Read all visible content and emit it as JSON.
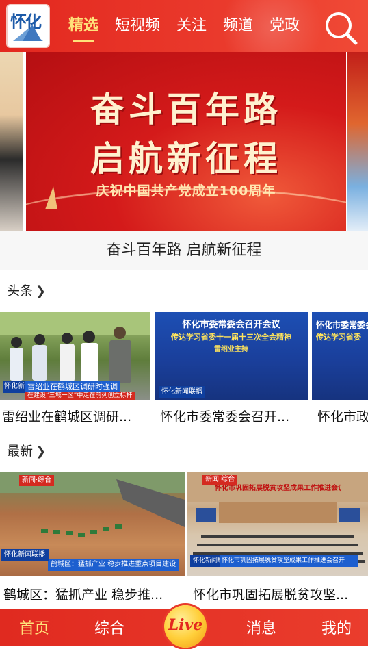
{
  "header": {
    "logo_text": "怀化",
    "tabs": [
      {
        "label": "精选",
        "active": true
      },
      {
        "label": "短视频",
        "active": false
      },
      {
        "label": "关注",
        "active": false
      },
      {
        "label": "频道",
        "active": false
      },
      {
        "label": "党政",
        "active": false
      }
    ],
    "search_icon": "search-icon",
    "colors": {
      "bar": "#e3281f",
      "active_tab": "#ffe27a"
    }
  },
  "banner": {
    "title_line1": "奋斗百年路",
    "title_line2": "启航新征程",
    "subtitle": "庆祝中国共产党成立100周年",
    "caption": "奋斗百年路 启航新征程"
  },
  "headlines": {
    "section_label": "头条",
    "section_icon": "chevron-right-icon",
    "cards": [
      {
        "caption": "雷绍业在鹤城区调研...",
        "badge": "怀化新闻联播",
        "lower_third_1": "雷绍业在鹤城区调研时强调",
        "lower_third_2": "在建设“三城一区”中走在前列创立标杆"
      },
      {
        "caption": "怀化市委常委会召开...",
        "badge": "怀化新闻联播",
        "screen_heading": "怀化市委常委会召开会议",
        "screen_subheading": "传达学习省委十一届十三次全会精神",
        "screen_host": "雷绍业主持"
      },
      {
        "caption": "怀化市政",
        "screen_heading": "怀化市委常委会",
        "screen_subheading": "传达学习省委"
      }
    ]
  },
  "latest": {
    "section_label": "最新",
    "section_icon": "chevron-right-icon",
    "cards": [
      {
        "caption": "鹤城区：猛抓产业 稳步推...",
        "badge": "怀化新闻联播",
        "lower_third": "鹤城区：猛抓产业 稳步推进重点项目建设",
        "tag": "新闻·综合"
      },
      {
        "caption": "怀化市巩固拓展脱贫攻坚...",
        "badge": "怀化新闻联播",
        "lower_third": "怀化市巩固拓展脱贫攻坚成果工作推进会召开",
        "banner_text": "怀化市巩固拓展脱贫攻坚成果工作推进会议",
        "tag": "新闻·综合"
      }
    ]
  },
  "bottom_nav": {
    "items": [
      {
        "label": "首页",
        "active": true
      },
      {
        "label": "综合",
        "active": false
      },
      {
        "label": "Live",
        "active": false
      },
      {
        "label": "消息",
        "active": false
      },
      {
        "label": "我的",
        "active": false
      }
    ]
  }
}
